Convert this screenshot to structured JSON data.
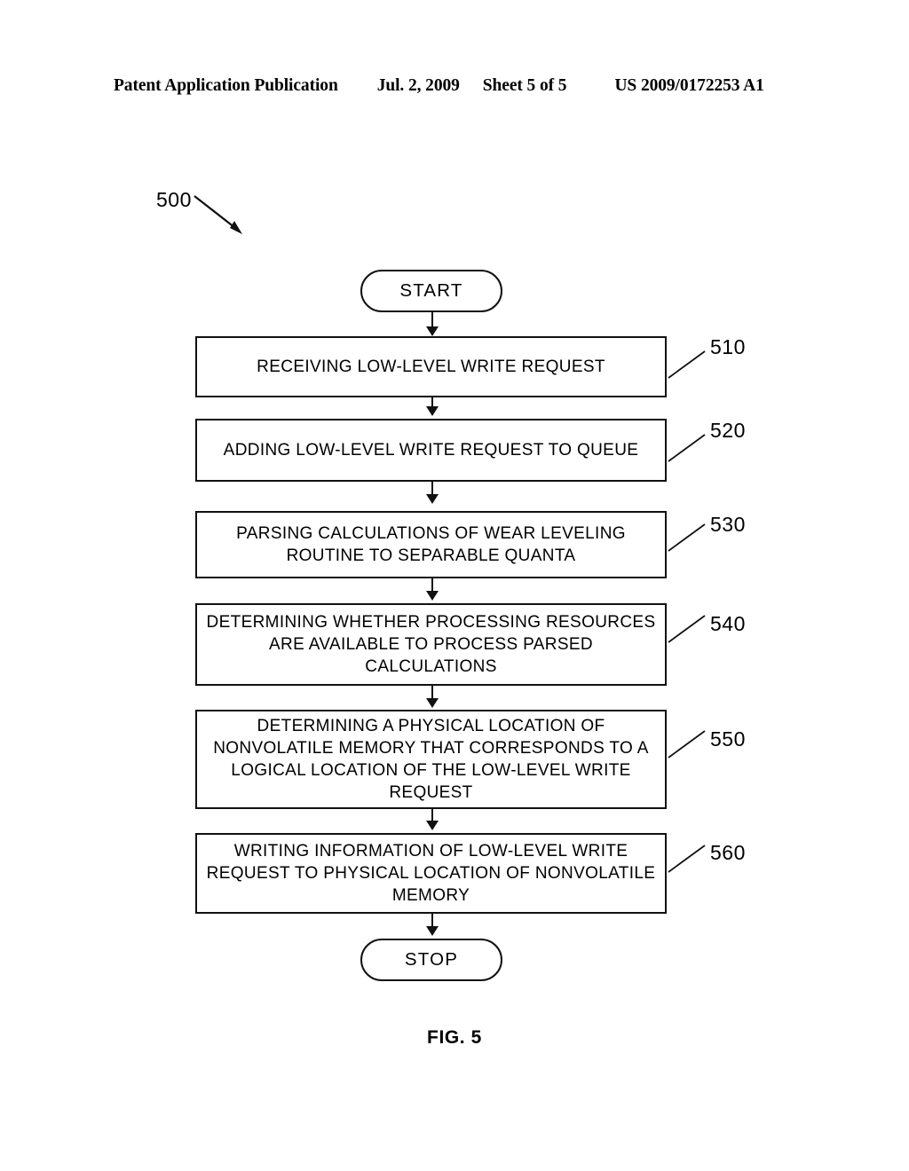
{
  "header": {
    "publication": "Patent Application Publication",
    "date": "Jul. 2, 2009",
    "sheet": "Sheet 5 of 5",
    "patent_number": "US 2009/0172253 A1"
  },
  "figure": {
    "caption": "FIG. 5",
    "diagram_reference": "500",
    "type": "flowchart",
    "nodes": [
      {
        "id": "start",
        "shape": "terminator",
        "label": "START",
        "ref": null
      },
      {
        "id": "510",
        "shape": "process",
        "label": "RECEIVING LOW-LEVEL WRITE REQUEST",
        "ref": "510"
      },
      {
        "id": "520",
        "shape": "process",
        "label": "ADDING LOW-LEVEL WRITE REQUEST TO QUEUE",
        "ref": "520"
      },
      {
        "id": "530",
        "shape": "process",
        "label": "PARSING CALCULATIONS OF WEAR LEVELING ROUTINE TO SEPARABLE QUANTA",
        "ref": "530"
      },
      {
        "id": "540",
        "shape": "process",
        "label": "DETERMINING WHETHER PROCESSING RESOURCES ARE AVAILABLE TO PROCESS PARSED CALCULATIONS",
        "ref": "540"
      },
      {
        "id": "550",
        "shape": "process",
        "label": "DETERMINING A PHYSICAL LOCATION OF NONVOLATILE MEMORY THAT CORRESPONDS TO A LOGICAL LOCATION OF THE LOW-LEVEL WRITE REQUEST",
        "ref": "550"
      },
      {
        "id": "560",
        "shape": "process",
        "label": "WRITING INFORMATION OF LOW-LEVEL WRITE REQUEST TO PHYSICAL LOCATION OF NONVOLATILE MEMORY",
        "ref": "560"
      },
      {
        "id": "stop",
        "shape": "terminator",
        "label": "STOP",
        "ref": null
      }
    ]
  }
}
